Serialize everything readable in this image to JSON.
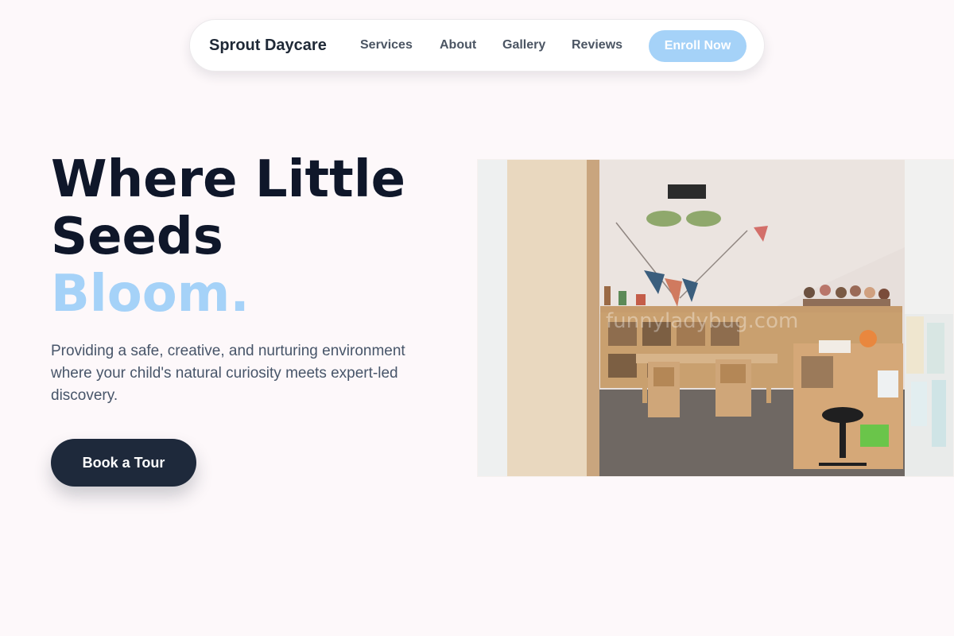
{
  "nav": {
    "brand": "Sprout Daycare",
    "links": [
      {
        "label": "Services"
      },
      {
        "label": "About"
      },
      {
        "label": "Gallery"
      },
      {
        "label": "Reviews"
      }
    ],
    "cta": "Enroll Now"
  },
  "hero": {
    "title_line1": "Where Little",
    "title_line2": "Seeds",
    "title_accent": "Bloom.",
    "description": "Providing a safe, creative, and nurturing environment where your child's natural curiosity meets expert-led discovery.",
    "button": "Book a Tour",
    "image_watermark": "funnyladybug.com"
  },
  "colors": {
    "background": "#fdf8fa",
    "accent": "#a5d2f8",
    "dark": "#1e293b",
    "text_muted": "#475569"
  }
}
